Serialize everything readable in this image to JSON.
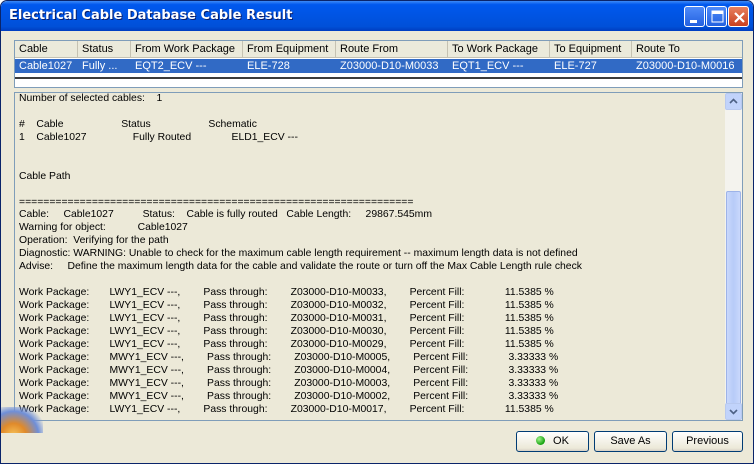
{
  "window": {
    "title": "Electrical Cable Database Cable Result"
  },
  "grid": {
    "columns": [
      "Cable",
      "Status",
      "From Work Package",
      "From Equipment",
      "Route From",
      "To Work Package",
      "To Equipment",
      "Route To"
    ],
    "rows": [
      [
        "Cable1027",
        "Fully ...",
        "EQT2_ECV ---",
        "ELE-728",
        "Z03000-D10-M0033",
        "EQT1_ECV ---",
        "ELE-727",
        "Z03000-D10-M0016"
      ]
    ]
  },
  "report": {
    "lines": [
      "Number of selected cables:    1",
      "",
      "#    Cable                    Status                    Schematic",
      "1    Cable1027                Fully Routed              ELD1_ECV ---",
      "",
      "",
      "Cable Path",
      "",
      "=================================================================",
      "Cable:     Cable1027          Status:    Cable is fully routed   Cable Length:     29867.545mm",
      "Warning for object:           Cable1027",
      "Operation:  Verifying for the path",
      "Diagnostic: WARNING: Unable to check for the maximum cable length requirement -- maximum length data is not defined",
      "Advise:     Define the maximum length data for the cable and validate the route or turn off the Max Cable Length rule check",
      "",
      "Work Package:       LWY1_ECV ---,        Pass through:        Z03000-D10-M0033,        Percent Fill:              11.5385 %",
      "Work Package:       LWY1_ECV ---,        Pass through:        Z03000-D10-M0032,        Percent Fill:              11.5385 %",
      "Work Package:       LWY1_ECV ---,        Pass through:        Z03000-D10-M0031,        Percent Fill:              11.5385 %",
      "Work Package:       LWY1_ECV ---,        Pass through:        Z03000-D10-M0030,        Percent Fill:              11.5385 %",
      "Work Package:       LWY1_ECV ---,        Pass through:        Z03000-D10-M0029,        Percent Fill:              11.5385 %",
      "Work Package:       MWY1_ECV ---,        Pass through:        Z03000-D10-M0005,        Percent Fill:              3.33333 %",
      "Work Package:       MWY1_ECV ---,        Pass through:        Z03000-D10-M0004,        Percent Fill:              3.33333 %",
      "Work Package:       MWY1_ECV ---,        Pass through:        Z03000-D10-M0003,        Percent Fill:              3.33333 %",
      "Work Package:       MWY1_ECV ---,        Pass through:        Z03000-D10-M0002,        Percent Fill:              3.33333 %",
      "Work Package:       LWY1_ECV ---,        Pass through:        Z03000-D10-M0017,        Percent Fill:              11.5385 %"
    ]
  },
  "buttons": {
    "ok": "OK",
    "save_as": "Save As",
    "previous": "Previous"
  },
  "icons": {
    "ok": "green-dot-icon",
    "minimize": "minimize-icon",
    "maximize": "maximize-icon",
    "close": "close-icon"
  }
}
